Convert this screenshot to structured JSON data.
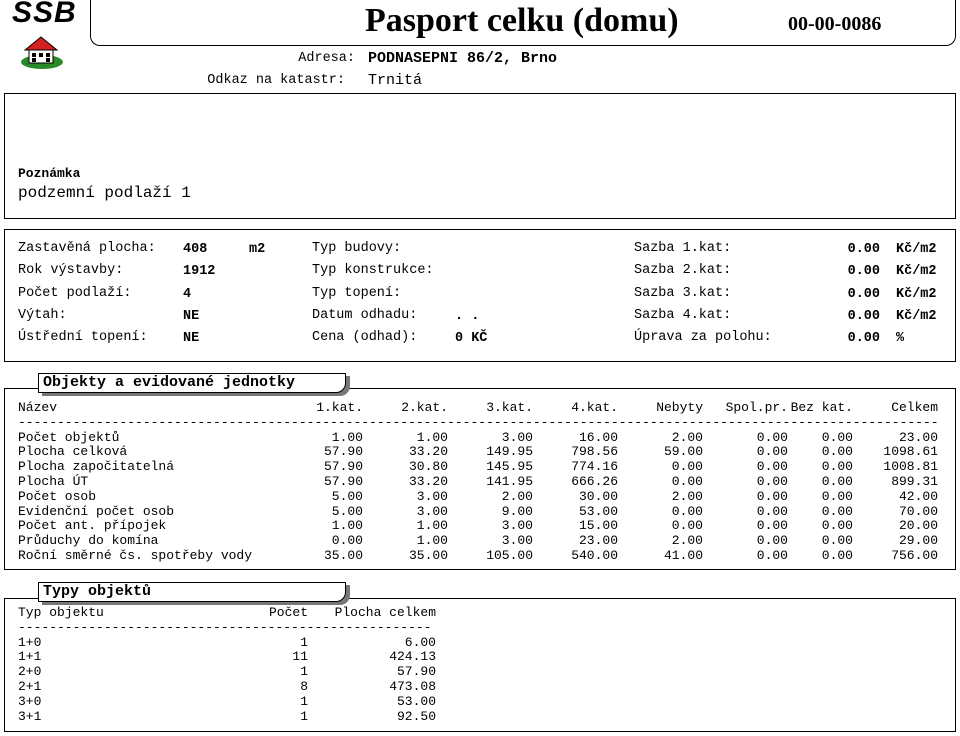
{
  "logo": {
    "text": "SSB"
  },
  "header": {
    "title": "Pasport celku (domu)",
    "code": "00-00-0086"
  },
  "address": {
    "adresa_label": "Adresa:",
    "adresa_value": "PODNASEPNI 86/2, Brno",
    "katastr_label": "Odkaz na katastr:",
    "katastr_value": "Trnitá"
  },
  "note": {
    "label": "Poznámka",
    "value": "podzemní podlaží 1"
  },
  "params": {
    "left": [
      {
        "label": "Zastavěná plocha:",
        "value": "408",
        "unit": "m2"
      },
      {
        "label": "Rok výstavby:",
        "value": "1912",
        "unit": ""
      },
      {
        "label": "Počet podlaží:",
        "value": "4",
        "unit": ""
      },
      {
        "label": "Výtah:",
        "value": "NE",
        "unit": ""
      },
      {
        "label": "Ústřední topení:",
        "value": "NE",
        "unit": ""
      }
    ],
    "middle": [
      {
        "label": "Typ budovy:",
        "value": ""
      },
      {
        "label": "Typ konstrukce:",
        "value": ""
      },
      {
        "label": "Typ topení:",
        "value": ""
      },
      {
        "label": "Datum odhadu:",
        "value": ". ."
      },
      {
        "label": "Cena (odhad):",
        "value": "0 KČ"
      }
    ],
    "right": [
      {
        "label": "Sazba 1.kat:",
        "value": "0.00",
        "unit": "Kč/m2"
      },
      {
        "label": "Sazba 2.kat:",
        "value": "0.00",
        "unit": "Kč/m2"
      },
      {
        "label": "Sazba 3.kat:",
        "value": "0.00",
        "unit": "Kč/m2"
      },
      {
        "label": "Sazba 4.kat:",
        "value": "0.00",
        "unit": "Kč/m2"
      },
      {
        "label": "Úprava za polohu:",
        "value": "0.00",
        "unit": "%"
      }
    ]
  },
  "objects": {
    "section_title": "Objekty a evidované jednotky",
    "headers": [
      "Název",
      "1.kat.",
      "2.kat.",
      "3.kat.",
      "4.kat.",
      "Nebyty",
      "Spol.pr.",
      "Bez kat.",
      "Celkem"
    ],
    "rows": [
      [
        "Počet objektů",
        "1.00",
        "1.00",
        "3.00",
        "16.00",
        "2.00",
        "0.00",
        "0.00",
        "23.00"
      ],
      [
        "Plocha celková",
        "57.90",
        "33.20",
        "149.95",
        "798.56",
        "59.00",
        "0.00",
        "0.00",
        "1098.61"
      ],
      [
        "Plocha započitatelná",
        "57.90",
        "30.80",
        "145.95",
        "774.16",
        "0.00",
        "0.00",
        "0.00",
        "1008.81"
      ],
      [
        "Plocha ÚT",
        "57.90",
        "33.20",
        "141.95",
        "666.26",
        "0.00",
        "0.00",
        "0.00",
        "899.31"
      ],
      [
        "Počet osob",
        "5.00",
        "3.00",
        "2.00",
        "30.00",
        "2.00",
        "0.00",
        "0.00",
        "42.00"
      ],
      [
        "Evidenční počet osob",
        "5.00",
        "3.00",
        "9.00",
        "53.00",
        "0.00",
        "0.00",
        "0.00",
        "70.00"
      ],
      [
        "Počet ant. přípojek",
        "1.00",
        "1.00",
        "3.00",
        "15.00",
        "0.00",
        "0.00",
        "0.00",
        "20.00"
      ],
      [
        "Průduchy do komína",
        "0.00",
        "1.00",
        "3.00",
        "23.00",
        "2.00",
        "0.00",
        "0.00",
        "29.00"
      ],
      [
        "Roční směrné čs. spotřeby vody",
        "35.00",
        "35.00",
        "105.00",
        "540.00",
        "41.00",
        "0.00",
        "0.00",
        "756.00"
      ]
    ]
  },
  "types": {
    "section_title": "Typy objektů",
    "headers": [
      "Typ objektu",
      "Počet",
      "Plocha celkem"
    ],
    "rows": [
      [
        "1+0",
        "1",
        "6.00"
      ],
      [
        "1+1",
        "11",
        "424.13"
      ],
      [
        "2+0",
        "1",
        "57.90"
      ],
      [
        "2+1",
        "8",
        "473.08"
      ],
      [
        "3+0",
        "1",
        "53.00"
      ],
      [
        "3+1",
        "1",
        "92.50"
      ]
    ]
  }
}
